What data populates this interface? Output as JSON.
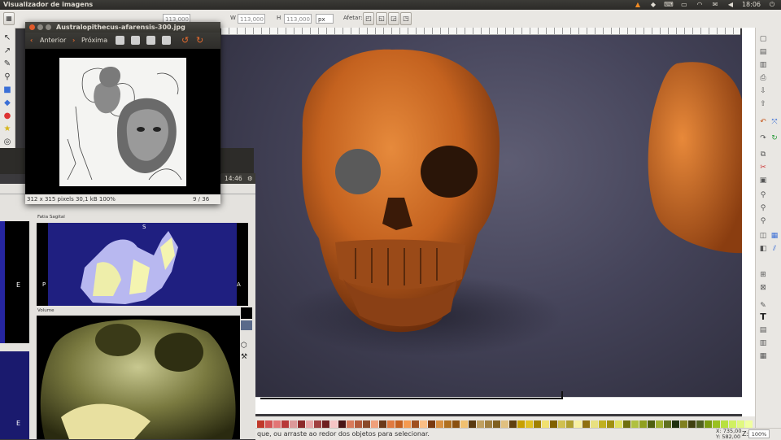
{
  "panel": {
    "title": "Visualizador de imagens",
    "time": "18:06",
    "tray_icons": [
      "vlc-icon",
      "dropbox-icon",
      "keyboard-icon",
      "battery-icon",
      "wifi-icon",
      "mail-icon",
      "volume-icon",
      "power-icon"
    ]
  },
  "controls": {
    "x_value": "113,000",
    "w_label": "W",
    "w_value": "113,000",
    "h_label": "H",
    "h_value": "113,000",
    "unit": "px",
    "affect_label": "Afetar:"
  },
  "viewer": {
    "title": "Australopithecus-afarensis-300.jpg",
    "prev_label": "Anterior",
    "next_label": "Próxima",
    "info": "312 x 315 pixels  30,1 kB   100%",
    "position": "9 / 36"
  },
  "background_app": {
    "clock": "14:46"
  },
  "medical": {
    "sagittal_label": "Fatia Sagital",
    "volume_label": "Volume",
    "sagittal_s": "S",
    "sagittal_p": "P",
    "sagittal_a": "A",
    "left_e1": "E",
    "left_e2": "E"
  },
  "status": {
    "message": "que, ou arraste ao redor dos objetos para selecionar.",
    "x_coord": "X: 735,00",
    "y_coord": "Y: 582,00",
    "z_label": "Z:",
    "zoom": "100%"
  },
  "colors": {
    "canvas_bg": "#45445a",
    "skull": "#d0722a",
    "eye_patch": "#5a5a5a",
    "sagittal_bg": "#1f1f80",
    "close_btn": "#e05a2b"
  }
}
